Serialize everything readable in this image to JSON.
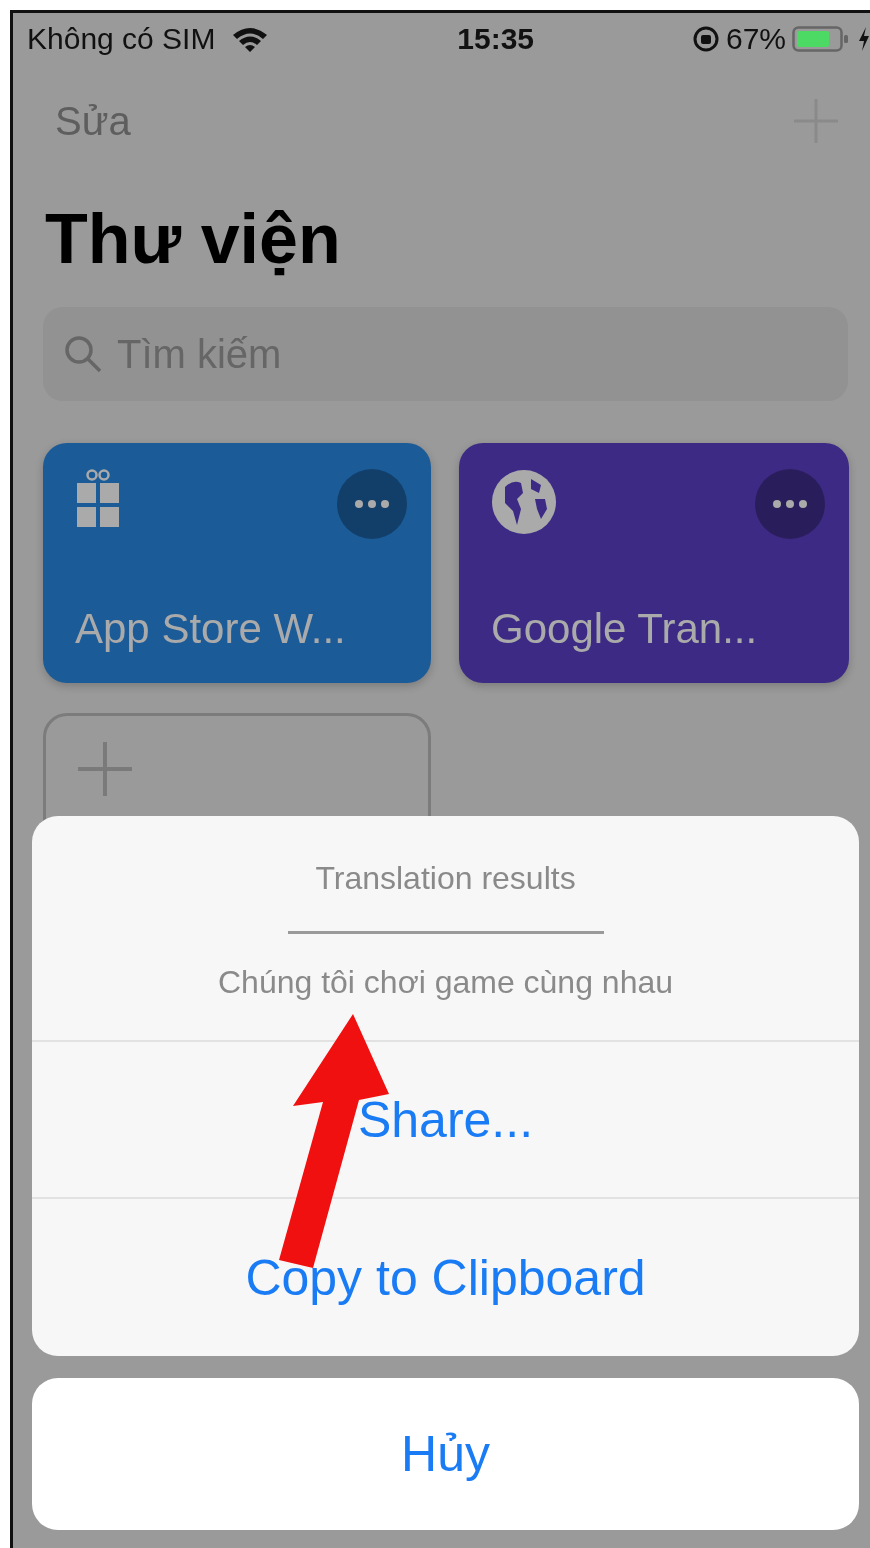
{
  "status_bar": {
    "carrier": "Không có SIM",
    "time": "15:35",
    "battery": "67%"
  },
  "nav": {
    "edit": "Sửa"
  },
  "title": "Thư viện",
  "search": {
    "placeholder": "Tìm kiếm"
  },
  "shortcuts": [
    {
      "name": "App Store W...",
      "kind": "gift",
      "color": "#1b5b98"
    },
    {
      "name": "Google Tran...",
      "kind": "globe",
      "color": "#3d2a85"
    }
  ],
  "action_sheet": {
    "title": "Translation results",
    "message": "Chúng tôi chơi game cùng nhau",
    "actions": [
      "Share...",
      "Copy to Clipboard"
    ],
    "cancel": "Hủy"
  }
}
